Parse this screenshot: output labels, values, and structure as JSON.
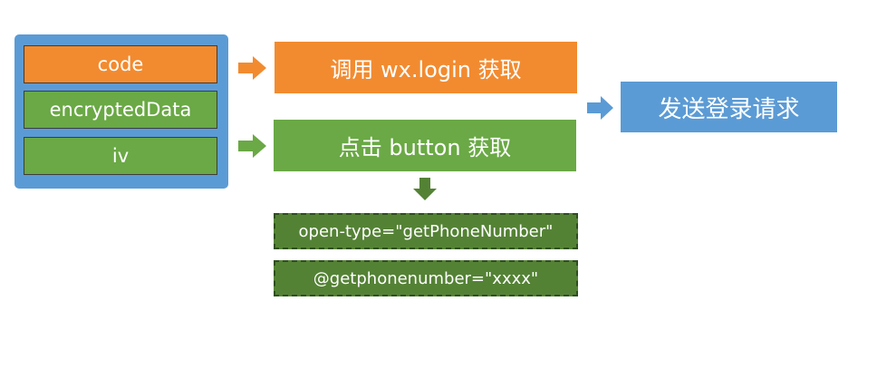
{
  "params": [
    {
      "label": "code",
      "color": "#f28b30"
    },
    {
      "label": "encryptedData",
      "color": "#6aa945"
    },
    {
      "label": "iv",
      "color": "#6aa945"
    }
  ],
  "steps": {
    "login": "调用 wx.login 获取",
    "button": "点击 button 获取",
    "request": "发送登录请求"
  },
  "attributes": [
    "open-type=\"getPhoneNumber\"",
    "@getphonenumber=\"xxxx\""
  ],
  "colors": {
    "orange": "#f28b30",
    "green": "#6aa945",
    "blue": "#5b9bd5",
    "dark_green": "#548235"
  }
}
